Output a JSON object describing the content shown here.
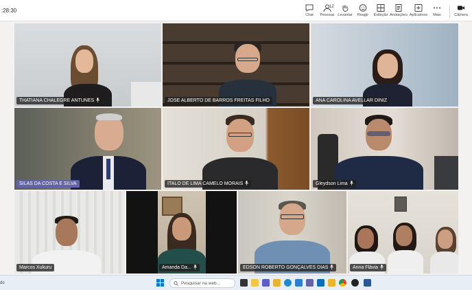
{
  "meeting": {
    "timer": ":28:30"
  },
  "toolbar": {
    "chat": "Chat",
    "people": "Pessoas",
    "people_count": "12",
    "raise": "Levantar",
    "react": "Reagir",
    "view": "Exibição",
    "notes": "Anotações",
    "apps": "Aplicativos",
    "more": "Mais",
    "camera": "Câmera"
  },
  "participants": [
    {
      "name": "THATIANA CHALEGRE ANTUNES"
    },
    {
      "name": "JOSE ALBERTO DE BARROS FREITAS FILHO"
    },
    {
      "name": "ANA CAROLINA AVELLAR DINIZ"
    },
    {
      "name": "SILAS DA COSTA E SILVA"
    },
    {
      "name": "ITALO DE LIMA CAMELO MORAIS"
    },
    {
      "name": "Gleydson Lima"
    },
    {
      "name": "Marcos Xukuru"
    },
    {
      "name": "Amanda Da..."
    },
    {
      "name": "EDSON ROBERTO GONÇALVES DIAS"
    },
    {
      "name": "Anna Flávia"
    }
  ],
  "taskbar": {
    "left_text": "do",
    "search_placeholder": "Pesquisar na web..."
  },
  "colors": {
    "teams_purple": "#6264a7",
    "taskbar_bg": "#e8eef5",
    "label_bg": "#201f1f"
  }
}
